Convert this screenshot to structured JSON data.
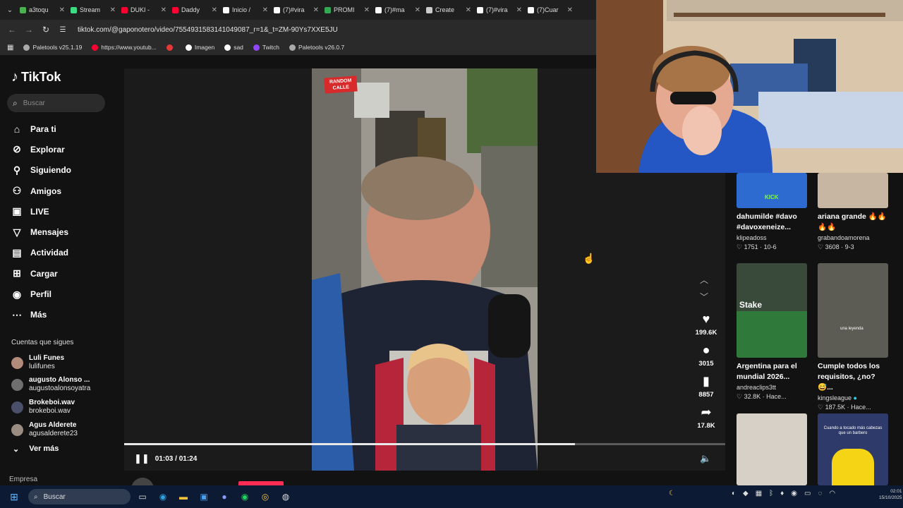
{
  "browser": {
    "tabs": [
      {
        "title": "a3toqu",
        "color": "#4caf50"
      },
      {
        "title": "Stream",
        "color": "#3ddc84"
      },
      {
        "title": "DUKI -",
        "color": "#ff0033"
      },
      {
        "title": "Daddy",
        "color": "#ff0033"
      },
      {
        "title": "Inicio /",
        "color": "#ffffff"
      },
      {
        "title": "(7)#vira",
        "color": "#ffffff"
      },
      {
        "title": "PROMI",
        "color": "#34a853"
      },
      {
        "title": "(7)#ma",
        "color": "#ffffff"
      },
      {
        "title": "Create",
        "color": "#cccccc"
      },
      {
        "title": "(7)#vira",
        "color": "#ffffff"
      },
      {
        "title": "(7)Cuar",
        "color": "#ffffff"
      }
    ],
    "url": "tiktok.com/@gaponotero/video/7554931583141049087_r=1&_t=ZM-90Ys7XXE5JU",
    "bookmarks": [
      "Paletools v25.1.19",
      "https://www.youtub...",
      "",
      "Imagen",
      "sad",
      "Twitch",
      "Paletools v26.0.7"
    ],
    "bookmark_icons": [
      "globe-icon",
      "youtube-icon",
      "heart-icon",
      "x-icon",
      "x-icon",
      "twitch-icon",
      "globe-icon"
    ]
  },
  "sidebar": {
    "brand": "TikTok",
    "search_placeholder": "Buscar",
    "menu": [
      {
        "label": "Para ti",
        "icon": "home-icon"
      },
      {
        "label": "Explorar",
        "icon": "compass-icon"
      },
      {
        "label": "Siguiendo",
        "icon": "following-icon"
      },
      {
        "label": "Amigos",
        "icon": "friends-icon"
      },
      {
        "label": "LIVE",
        "icon": "live-icon"
      },
      {
        "label": "Mensajes",
        "icon": "send-icon"
      },
      {
        "label": "Actividad",
        "icon": "activity-icon"
      },
      {
        "label": "Cargar",
        "icon": "upload-icon"
      },
      {
        "label": "Perfil",
        "icon": "profile-icon"
      },
      {
        "label": "Más",
        "icon": "more-icon"
      }
    ],
    "following_heading": "Cuentas que sigues",
    "following": [
      {
        "name": "Luli Funes",
        "handle": "lulifunes"
      },
      {
        "name": "augusto Alonso ...",
        "handle": "augustoalonsoyatra"
      },
      {
        "name": "Brokeboi.wav",
        "handle": "brokeboi.wav"
      },
      {
        "name": "Agus Alderete",
        "handle": "agusalderete23"
      }
    ],
    "see_more": "Ver más",
    "footer": "Empresa"
  },
  "player": {
    "likes": "199.6K",
    "comments": "3015",
    "saves": "8857",
    "shares": "17.8K",
    "time": "01:03 / 01:24",
    "progress": 0.75,
    "owner": "gaponotero",
    "sticker": "RANDOM CALLE"
  },
  "recommendations": [
    {
      "title": "dahumilde #davo #davoxeneize...",
      "user": "klipeadoss",
      "likes": "1751",
      "date": "10-6",
      "verified": false
    },
    {
      "title": "ariana grande 🔥🔥🔥🔥",
      "user": "grabandoamorena",
      "likes": "3608",
      "date": "9-3",
      "verified": false
    },
    {
      "title": "Argentina para el mundial 2026...",
      "user": "andreaclips3tt",
      "likes": "32.8K",
      "date": "Hace...",
      "verified": false
    },
    {
      "title": "Cumple todos los requisitos, ¿no? 😅...",
      "user": "kingsleague",
      "likes": "187.5K",
      "date": "Hace...",
      "verified": true
    },
    {
      "title": "",
      "user": "",
      "likes": "",
      "date": ""
    },
    {
      "title": "",
      "user": "",
      "likes": "",
      "date": ""
    }
  ],
  "rec_overlays": {
    "kick": "KICK",
    "stake": "Stake",
    "leyenda": "una leyenda",
    "tocado": "Cuando a tocado más cabezas que un barbero"
  },
  "taskbar": {
    "search_placeholder": "Buscar",
    "time": "02:01",
    "date": "15/10/2025"
  }
}
